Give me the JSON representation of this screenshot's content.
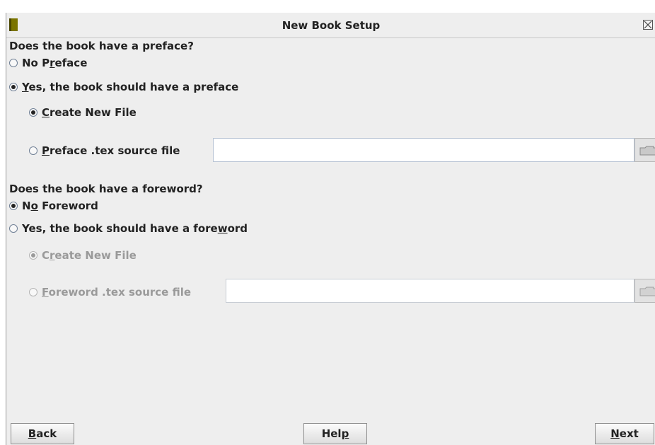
{
  "window": {
    "title": "New Book Setup"
  },
  "preface": {
    "question": "Does the book have a preface?",
    "no_option": {
      "before": "No P",
      "mnemonic": "r",
      "after": "eface",
      "checked": false
    },
    "yes_option": {
      "before": "",
      "mnemonic": "Y",
      "after": "es, the book should have a preface",
      "checked": true
    },
    "create_new": {
      "before": "",
      "mnemonic": "C",
      "after": "reate New File",
      "checked": true
    },
    "source_file": {
      "before": "",
      "mnemonic": "P",
      "after": "reface .tex source file",
      "checked": false
    },
    "source_value": ""
  },
  "foreword": {
    "question": "Does the book have a foreword?",
    "no_option": {
      "before": "N",
      "mnemonic": "o",
      "after": " Foreword",
      "checked": true
    },
    "yes_option": {
      "before": "Yes, the book should have a fore",
      "mnemonic": "w",
      "after": "ord",
      "checked": false
    },
    "create_new": {
      "before": "C",
      "mnemonic": "r",
      "after": "eate New File",
      "checked": true,
      "disabled": true
    },
    "source_file": {
      "before": "",
      "mnemonic": "F",
      "after": "oreword .tex source file",
      "checked": false,
      "disabled": true
    },
    "source_value": ""
  },
  "buttons": {
    "back": {
      "before": "",
      "mnemonic": "B",
      "after": "ack"
    },
    "help": {
      "before": "Hel",
      "mnemonic": "p",
      "after": ""
    },
    "next": {
      "before": "",
      "mnemonic": "N",
      "after": "ext"
    }
  },
  "icons": {
    "app": "book-icon",
    "close": "close-icon",
    "browse": "folder-icon"
  },
  "colors": {
    "window_bg": "#eeeeee",
    "text": "#222222",
    "disabled_text": "#9a9a9a",
    "field_border": "#b8c4d4"
  }
}
